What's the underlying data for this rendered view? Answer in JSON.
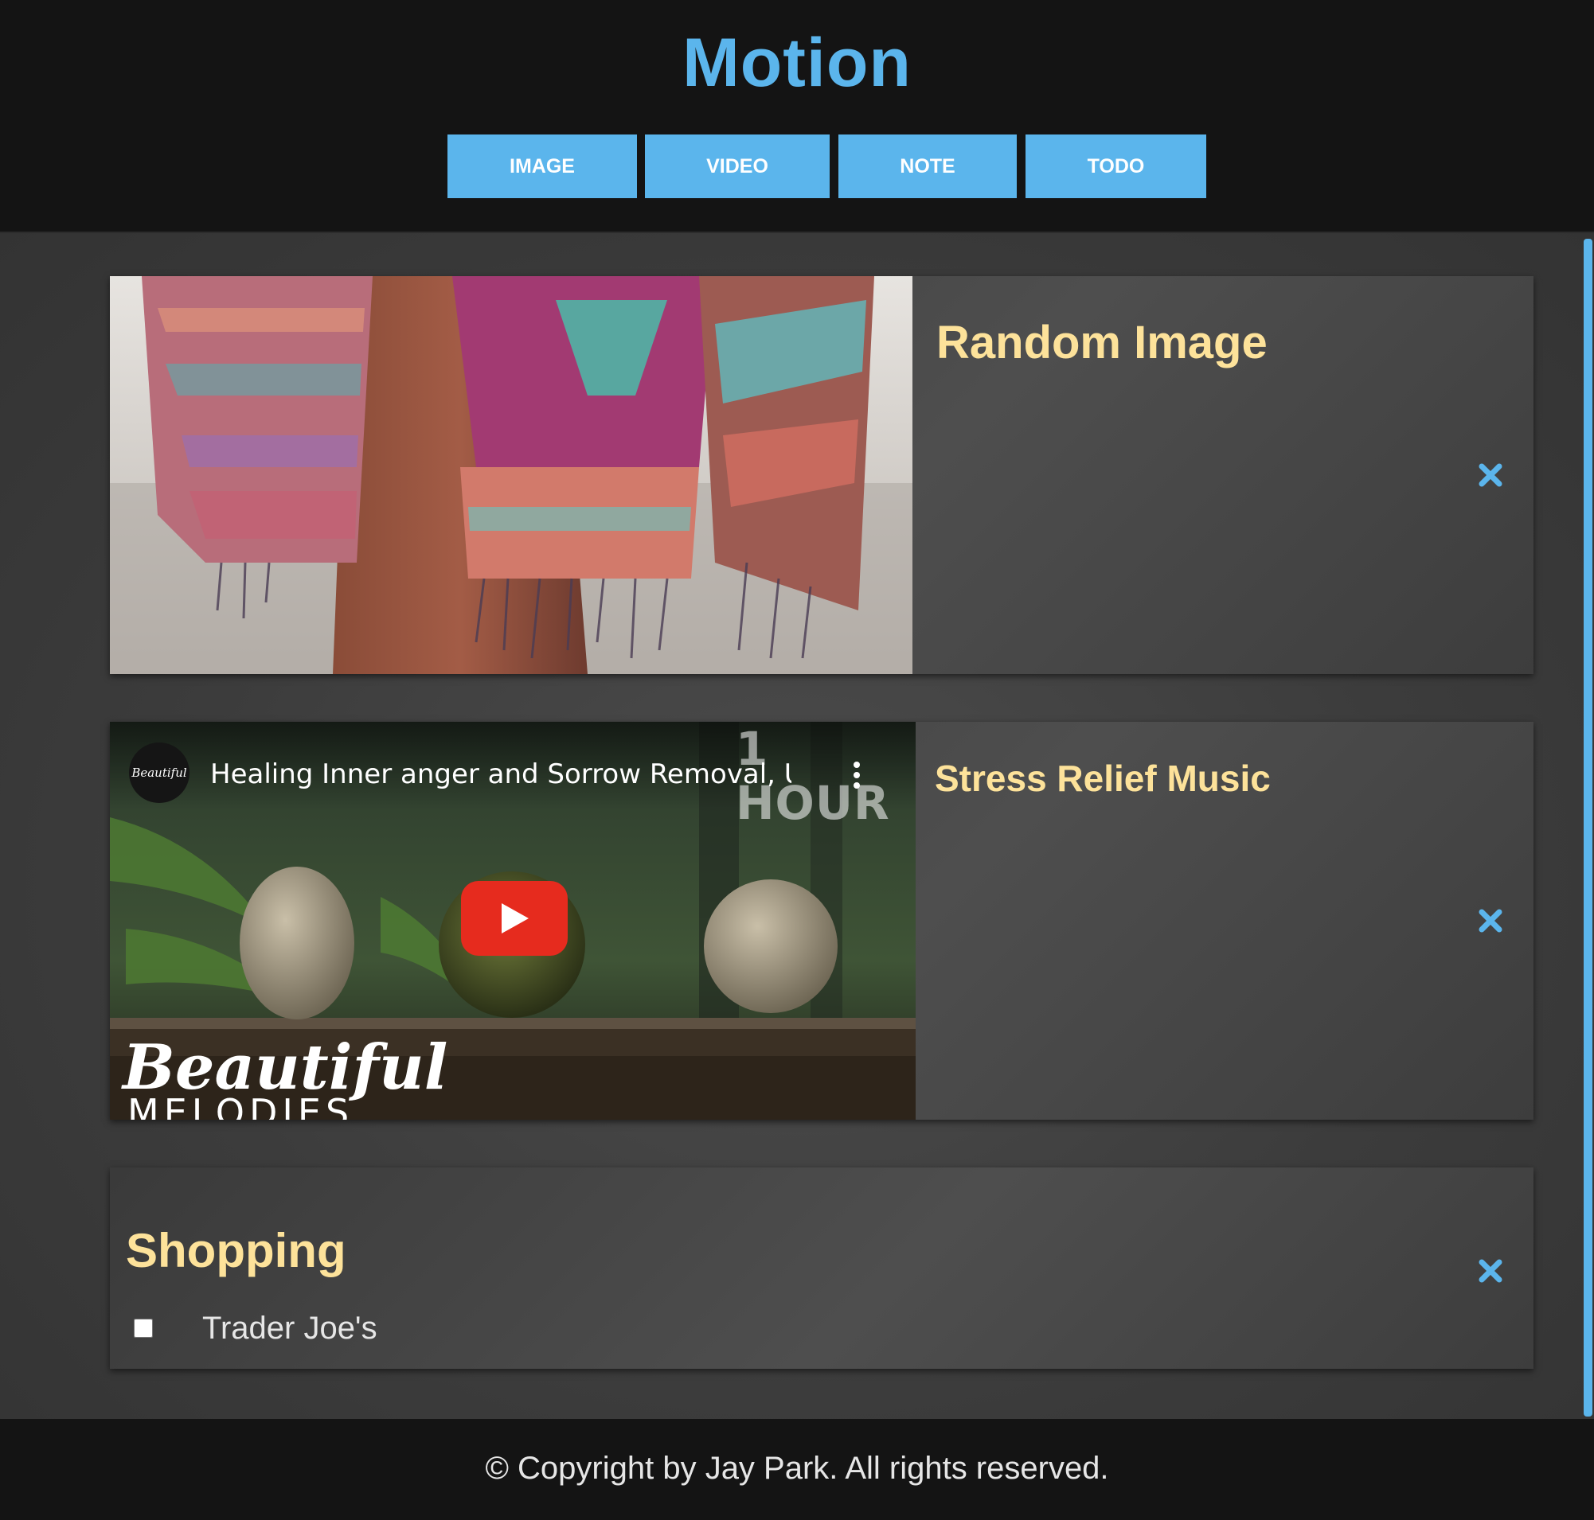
{
  "header": {
    "logo": "Motion",
    "buttons": [
      {
        "label": "IMAGE"
      },
      {
        "label": "VIDEO"
      },
      {
        "label": "NOTE"
      },
      {
        "label": "TODO"
      }
    ]
  },
  "cards": [
    {
      "type": "image",
      "title": "Random Image",
      "image": "woven-blanket-photo",
      "close_icon": "close-icon"
    },
    {
      "type": "video",
      "title": "Stress Relief Music",
      "video": {
        "title": "Healing Inner anger and Sorrow Removal, Ultra...",
        "channel_avatar": "Beautiful Melodies",
        "badge": "1 HOUR",
        "brand": "Beautiful",
        "brand_sub": "MELODIES"
      },
      "close_icon": "close-icon"
    },
    {
      "type": "todo",
      "title": "Shopping",
      "items": [
        {
          "text": "Trader Joe's",
          "checked": false
        }
      ],
      "close_icon": "close-icon"
    }
  ],
  "footer": {
    "text": "© Copyright by Jay Park. All rights reserved."
  },
  "colors": {
    "accent": "#5bb5ec",
    "title": "#fde29a",
    "header_bg": "#141414",
    "play_red": "#e62b1e"
  }
}
